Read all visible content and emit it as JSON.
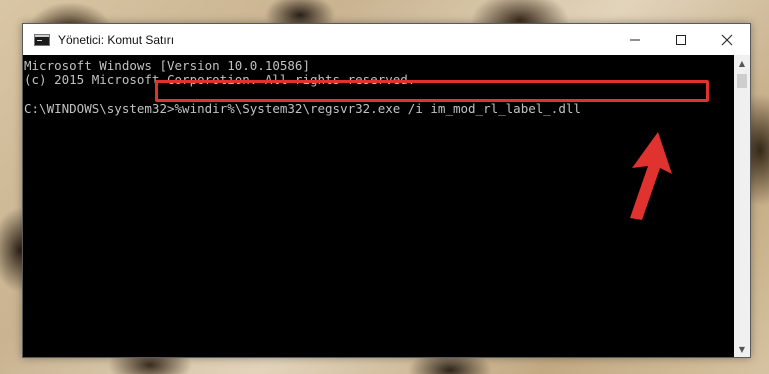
{
  "window": {
    "title": "Yönetici: Komut Satırı",
    "icon": "console-icon",
    "controls": {
      "minimize": "—",
      "maximize": "☐",
      "close": "✕"
    }
  },
  "console": {
    "lines": [
      "Microsoft Windows [Version 10.0.10586]",
      "(c) 2015 Microsoft Corporotion. All rights reserved."
    ],
    "prompt": "C:\\WINDOWS\\system32>",
    "command": "%windir%\\System32\\regsvr32.exe /i im_mod_rl_label_.dll"
  },
  "annotation": {
    "highlight_color": "#e0332f",
    "arrow_color": "#e0332f",
    "arrow_icon": "arrow-pointer-icon"
  },
  "colors": {
    "console_bg": "#000000",
    "console_text": "#c0c0c0",
    "titlebar_bg": "#ffffff"
  }
}
